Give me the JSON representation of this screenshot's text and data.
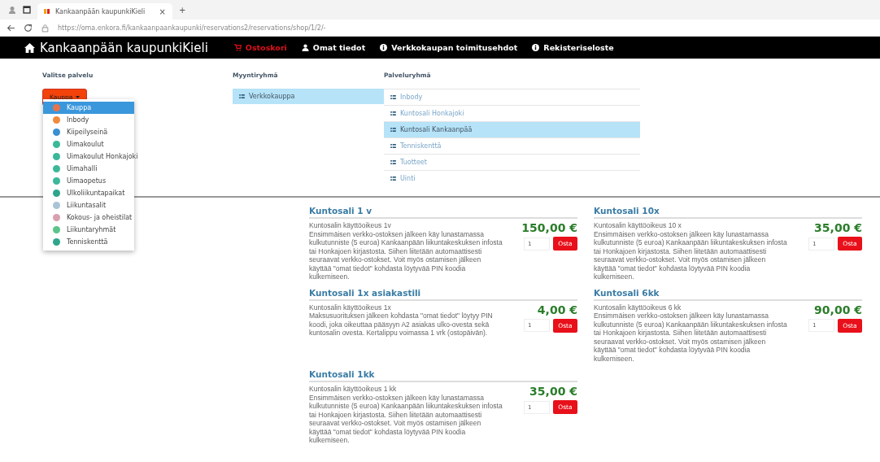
{
  "browser": {
    "tab_title": "Kankaanpään kaupunkiKieli",
    "tab_close": "×",
    "new_tab": "+",
    "url": "https://oma.enkora.fi/kankaanpaankaupunki/reservations2/reservations/shop/1/2/-"
  },
  "nav": {
    "brand": "Kankaanpään kaupunkiKieli",
    "items": [
      {
        "label": "Ostoskori",
        "kind": "cart",
        "selected": true
      },
      {
        "label": "Omat tiedot",
        "kind": "user",
        "selected": false
      },
      {
        "label": "Verkkokaupan toimitusehdot",
        "kind": "info",
        "selected": false
      },
      {
        "label": "Rekisteriseloste",
        "kind": "info",
        "selected": false
      }
    ]
  },
  "service": {
    "label": "Valitse palvelu",
    "button": "Kauppa",
    "menu": [
      {
        "label": "Kauppa",
        "selected": true,
        "color": "#e8734a"
      },
      {
        "label": "Inbody",
        "selected": false,
        "color": "#f08a3c"
      },
      {
        "label": "Kiipeilyseinä",
        "selected": false,
        "color": "#3a8fd0"
      },
      {
        "label": "Uimakoulut",
        "selected": false,
        "color": "#3bb89a"
      },
      {
        "label": "Uimakoulut Honkajoki",
        "selected": false,
        "color": "#3bb89a"
      },
      {
        "label": "Uimahalli",
        "selected": false,
        "color": "#3bb89a"
      },
      {
        "label": "Uimaopetus",
        "selected": false,
        "color": "#3bb89a"
      },
      {
        "label": "Ulkoliikuntapaikat",
        "selected": false,
        "color": "#2fa58c"
      },
      {
        "label": "Liikuntasalit",
        "selected": false,
        "color": "#a9c4d6"
      },
      {
        "label": "Kokous- ja oheistilat",
        "selected": false,
        "color": "#d9a0b0"
      },
      {
        "label": "Liikuntaryhmät",
        "selected": false,
        "color": "#5cc48a"
      },
      {
        "label": "Tenniskenttä",
        "selected": false,
        "color": "#2fa58c"
      }
    ]
  },
  "sales_group": {
    "label": "Myyntiryhmä",
    "items": [
      {
        "label": "Verkkokauppa",
        "selected": true
      }
    ]
  },
  "service_group": {
    "label": "Palveluryhmä",
    "items": [
      {
        "label": "Inbody",
        "selected": false
      },
      {
        "label": "Kuntosali Honkajoki",
        "selected": false
      },
      {
        "label": "Kuntosali Kankaanpää",
        "selected": true
      },
      {
        "label": "Tenniskenttä",
        "selected": false
      },
      {
        "label": "Tuotteet",
        "selected": false
      },
      {
        "label": "Uinti",
        "selected": false
      }
    ]
  },
  "products": [
    {
      "title": "Kuntosali 1 v",
      "subtitle": "Kuntosalin käyttöoikeus 1v",
      "description": "Ensimmäisen verkko-ostoksen jälkeen käy lunastamassa kulkutunniste (5 euroa) Kankaanpään liikuntakeskuksen infosta tai Honkajoen kirjastosta. Siihen liitetään automaattisesti seuraavat verkko-ostokset. Voit myös ostamisen jälkeen käyttää \"omat tiedot\" kohdasta löytyvää PIN koodia kulkemiseen.",
      "price": "150,00 €",
      "quantity": "1",
      "buy": "Osta"
    },
    {
      "title": "Kuntosali 10x",
      "subtitle": "Kuntosalin käyttöoikeus 10 x",
      "description": "Ensimmäisen verkko-ostoksen jälkeen käy lunastamassa kulkutunniste (5 euroa) Kankaanpään liikuntakeskuksen infosta tai Honkajoen kirjastosta. Siihen liitetään automaattisesti seuraavat verkko-ostokset. Voit myös ostamisen jälkeen käyttää \"omat tiedot\" kohdasta löytyvää PIN koodia kulkemiseen.",
      "price": "35,00 €",
      "quantity": "1",
      "buy": "Osta"
    },
    {
      "title": "Kuntosali 1x asiakastili",
      "subtitle": "Kuntosalin käyttöoikeus 1x",
      "description": "Maksusuorituksen jälkeen kohdasta \"omat tiedot\" löytyy PIN koodi, joka oikeuttaa pääsyyn A2 asiakas ulko-ovesta sekä kuntosalin ovesta. Kertalippu voimassa 1 vrk (ostopäivän).",
      "price": "4,00 €",
      "quantity": "1",
      "buy": "Osta"
    },
    {
      "title": "Kuntosali 6kk",
      "subtitle": "Kuntosalin käyttöoikeus 6 kk",
      "description": "Ensimmäisen verkko-ostoksen jälkeen käy lunastamassa kulkutunniste (5 euroa) Kankaanpään liikuntakeskuksen infosta tai Honkajoen kirjastosta. Siihen liitetään automaattisesti seuraavat verkko-ostokset. Voit myös ostamisen jälkeen käyttää \"omat tiedot\" kohdasta löytyvää PIN koodia kulkemiseen.",
      "price": "90,00 €",
      "quantity": "1",
      "buy": "Osta"
    },
    {
      "title": "Kuntosali 1kk",
      "subtitle": "Kuntosalin käyttöoikeus 1 kk",
      "description": "Ensimmäisen verkko-ostoksen jälkeen käy lunastamassa kulkutunniste (5 euroa) Kankaanpään liikuntakeskuksen infosta tai Honkajoen kirjastosta. Siihen liitetään automaattisesti seuraavat verkko-ostokset. Voit myös ostamisen jälkeen käyttää \"omat tiedot\" kohdasta löytyvää PIN koodia kulkemiseen.",
      "price": "35,00 €",
      "quantity": "1",
      "buy": "Osta"
    }
  ]
}
